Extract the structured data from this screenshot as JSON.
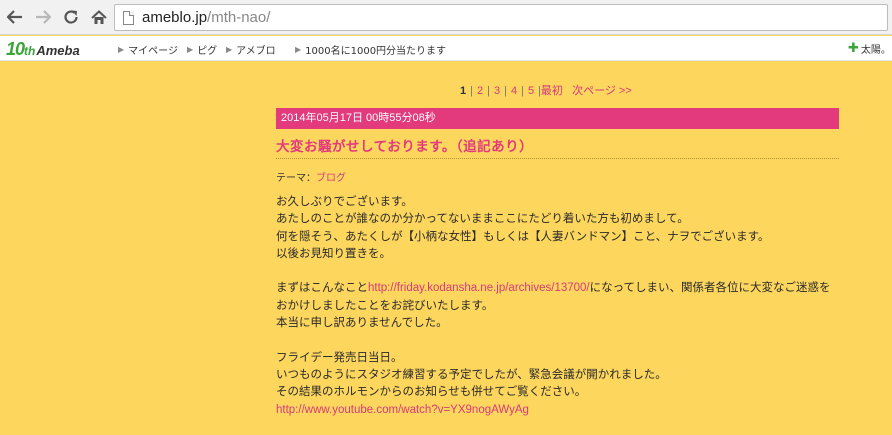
{
  "browser": {
    "url_domain": "ameblo.jp",
    "url_path": "/mth-nao/"
  },
  "ameba_bar": {
    "logo_num": "10",
    "logo_suffix": "th",
    "logo_name": "Ameba",
    "menu": [
      "マイページ",
      "ピグ",
      "アメブロ",
      "1000名に1000円分当たります"
    ],
    "user_name": "太陽。"
  },
  "pager": {
    "current": "1",
    "pages": [
      "2",
      "3",
      "4",
      "5"
    ],
    "last_label": "最初",
    "next_label": "次ページ >>"
  },
  "entry": {
    "date": "2014年05月17日 00時55分08秒",
    "title": "大変お騒がせしております。（追記あり）",
    "theme_label": "テーマ：",
    "theme_link": "ブログ",
    "line1": "お久しぶりでございます。",
    "line2": "あたしのことが誰なのか分かってないままここにたどり着いた方も初めまして。",
    "line3": "何を隠そう、あたくしが【小柄な女性】もしくは【人妻バンドマン】こと、ナヲでございます。",
    "line4": "以後お見知り置きを。",
    "line5_pre": "まずはこんなこと",
    "line5_link": "http://friday.kodansha.ne.jp/archives/13700/",
    "line5_post": "になってしまい、関係者各位に大変なご迷惑を",
    "line6": "おかけしましたことをお詫びいたします。",
    "line7": "本当に申し訳ありませんでした。",
    "line8": "フライデー発売日当日。",
    "line9": "いつものようにスタジオ練習する予定でしたが、緊急会議が開かれました。",
    "line10": "その結果のホルモンからのお知らせも併せてご覧ください。",
    "line11_link": "http://www.youtube.com/watch?v=YX9nogAWyAg"
  }
}
